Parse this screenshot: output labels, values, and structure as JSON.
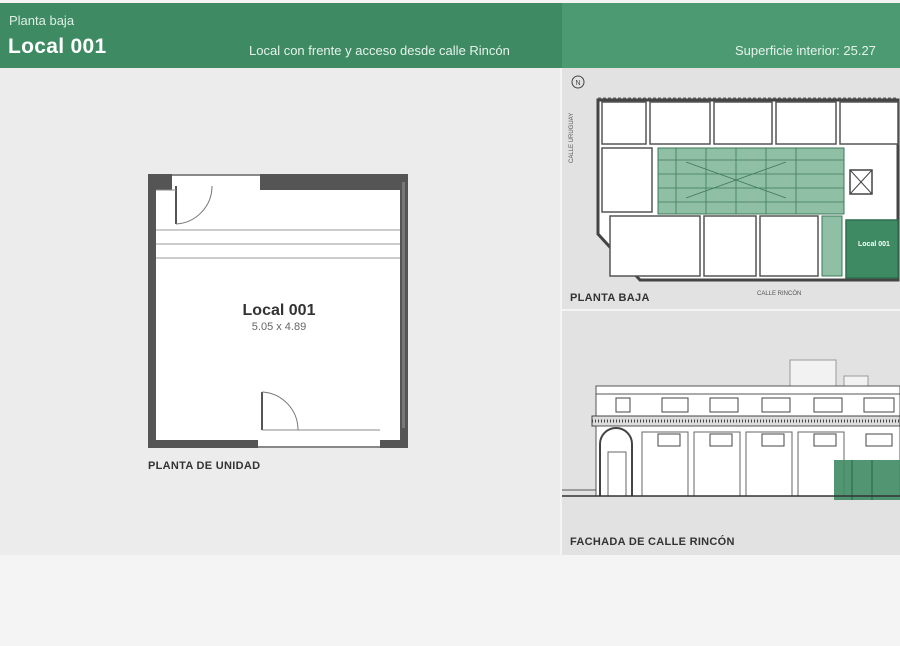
{
  "header": {
    "floor": "Planta baja",
    "unit": "Local 001",
    "description": "Local con frente y acceso desde calle Rincón",
    "surface": "Superficie interior: 25.27"
  },
  "unit_plan": {
    "name": "Local 001",
    "dimensions": "5.05 x 4.89",
    "caption": "PLANTA DE UNIDAD"
  },
  "site_plan": {
    "caption": "PLANTA BAJA",
    "street_bottom": "CALLE RINCÓN",
    "street_side": "CALLE URUGUAY",
    "highlight_label": "Local 001",
    "compass": "N"
  },
  "facade": {
    "caption": "FACHADA DE CALLE RINCÓN"
  },
  "colors": {
    "header_green": "#3e8a63",
    "highlight_green": "#3e8a63"
  }
}
